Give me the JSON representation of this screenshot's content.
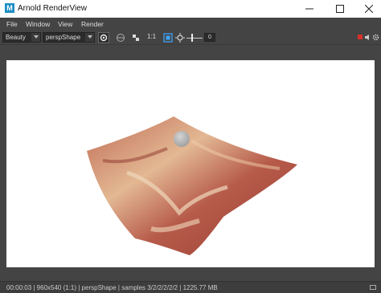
{
  "window": {
    "app_icon_letter": "M",
    "title": "Arnold RenderView",
    "controls": [
      "minimize-icon",
      "maximize-icon",
      "close-icon"
    ]
  },
  "menu": {
    "items": [
      "File",
      "Window",
      "View",
      "Render"
    ]
  },
  "toolbar": {
    "aov_value": "Beauty",
    "camera_value": "perspShape",
    "zoom_label": "1:1",
    "exposure_value": "0",
    "icons": [
      "render-region-icon",
      "refresh-icon",
      "crop-icon",
      "zoom-icon",
      "color-swatch-icon",
      "exposure-slider-icon",
      "stop-render-icon",
      "render-sound-icon",
      "settings-gear-icon"
    ],
    "accent_color": "#3fa6ff",
    "stop_color": "#d9302a"
  },
  "status": {
    "text": "00:00:03 | 960x540 (1:1) | perspShape | samples 3/2/2/2/2/2 | 1225.77 MB"
  },
  "render": {
    "description_colors": {
      "terrain_dark": "#9a3e34",
      "terrain_light": "#e7c9a7",
      "sphere": "#bdbdbd",
      "background": "#ffffff"
    }
  }
}
